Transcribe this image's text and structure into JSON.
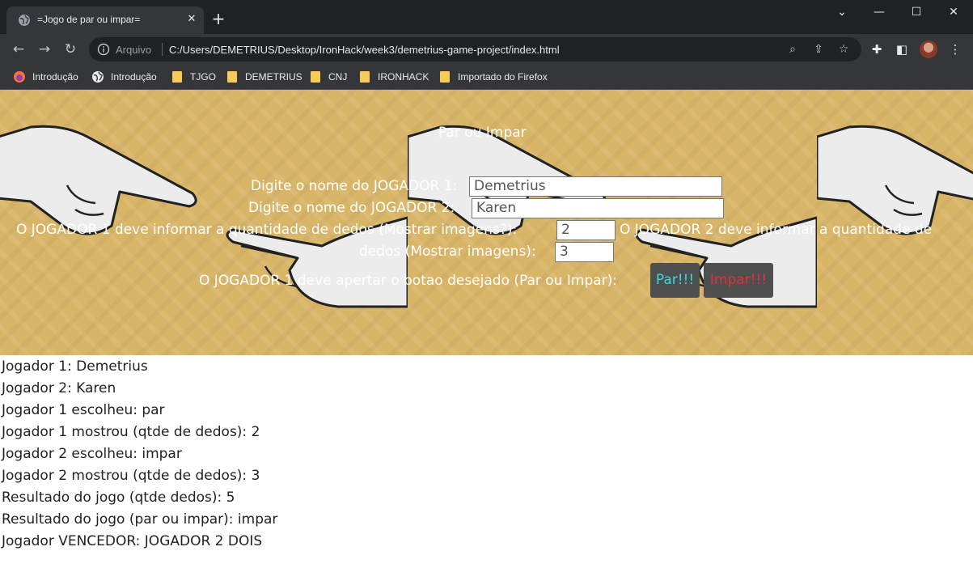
{
  "browser": {
    "tab_title": "=Jogo de par ou impar=",
    "new_tab_symbol": "+",
    "window_controls": [
      "⌄",
      "—",
      "☐",
      "✕"
    ],
    "address_scheme": "Arquivo",
    "address_url": "C:/Users/DEMETRIUS/Desktop/IronHack/week3/demetrius-game-project/index.html",
    "bookmarks": [
      {
        "label": "Introdução",
        "icon": "firefox-icon"
      },
      {
        "label": "Introdução",
        "icon": "globe-icon"
      },
      {
        "label": "TJGO",
        "icon": "folder-icon"
      },
      {
        "label": "DEMETRIUS",
        "icon": "folder-icon"
      },
      {
        "label": "CNJ",
        "icon": "folder-icon"
      },
      {
        "label": "IRONHACK",
        "icon": "folder-icon"
      },
      {
        "label": "Importado do Firefox",
        "icon": "folder-icon"
      }
    ]
  },
  "game": {
    "title": "Par ou Impar",
    "player1_prompt": "Digite o nome do JOGADOR 1:",
    "player1_name": "Demetrius",
    "player2_prompt": "Digite o nome do JOGADOR 2:",
    "player2_name": "Karen",
    "fingers_prompt_p1": "O JOGADOR 1 deve informar a quantidade de dedos (Mostrar imagens?):",
    "fingers_p1": "2",
    "fingers_prompt_p2_line1": "O JOGADOR 2 deve informar a quantidade de",
    "fingers_prompt_p2_line2": "dedos (Mostrar imagens):",
    "fingers_p2": "3",
    "choose_prompt": "O JOGADOR 1 deve apertar o botao desejado (Par ou Impar):",
    "par_button": "Par!!!",
    "impar_button": "Impar!!!",
    "par_color": "#3ed6e0",
    "impar_color": "#e0303c"
  },
  "results": [
    "Jogador 1: Demetrius",
    "Jogador 2: Karen",
    "Jogador 1 escolheu: par",
    "Jogador 1 mostrou (qtde de dedos): 2",
    "Jogador 2 escolheu: impar",
    "Jogador 2 mostrou (qtde de dedos): 3",
    "Resultado do jogo (qtde dedos): 5",
    "Resultado do jogo (par ou impar): impar",
    "Jogador VENCEDOR: JOGADOR 2 DOIS"
  ]
}
